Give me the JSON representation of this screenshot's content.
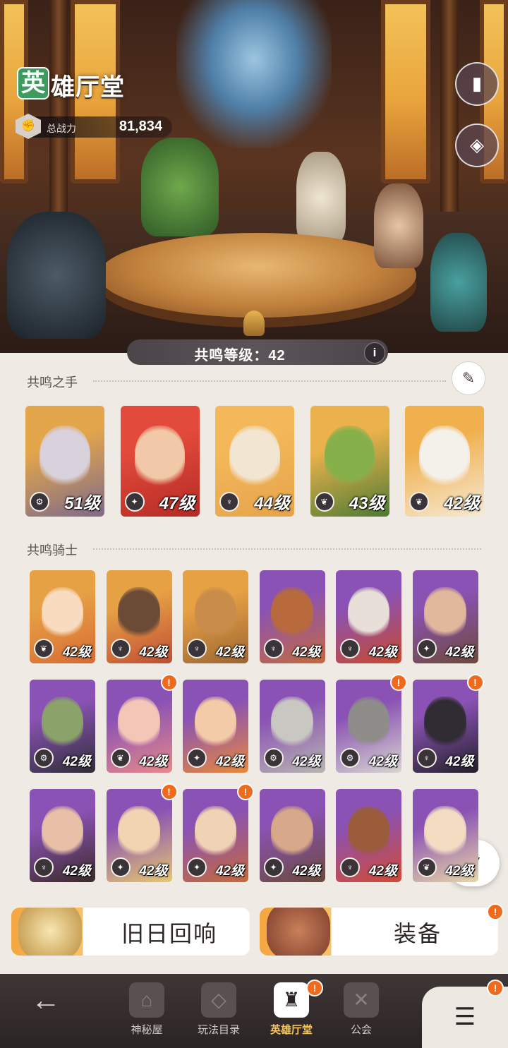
{
  "header": {
    "title_first_char": "英",
    "title_rest": "雄厅堂",
    "power_label": "总战力",
    "power_value": "81,834"
  },
  "top_buttons": [
    {
      "name": "book-icon",
      "glyph": "▮"
    },
    {
      "name": "armor-icon",
      "glyph": "◈"
    }
  ],
  "resonance": {
    "label": "共鸣等级：42",
    "info": "i"
  },
  "hands": {
    "title": "共鸣之手",
    "cards": [
      {
        "level": "51级",
        "art": [
          "#e3a64b",
          "#7f6a8a"
        ],
        "face": "#d9d2dd",
        "cls": "⚙"
      },
      {
        "level": "47级",
        "art": [
          "#e24b3b",
          "#b52a25"
        ],
        "face": "#f1c9a8",
        "cls": "✦"
      },
      {
        "level": "44级",
        "art": [
          "#f3b85a",
          "#e6a34a"
        ],
        "face": "#f2e6d2",
        "cls": "♆"
      },
      {
        "level": "43级",
        "art": [
          "#eab14c",
          "#4d7b33"
        ],
        "face": "#86b04a",
        "cls": "❦"
      },
      {
        "level": "42级",
        "art": [
          "#f0b04d",
          "#f6ead6"
        ],
        "face": "#f4f0ea",
        "cls": "❦"
      }
    ]
  },
  "knights": {
    "title": "共鸣骑士",
    "cards": [
      {
        "level": "42级",
        "art": [
          "#e7a145",
          "#d76b34"
        ],
        "face": "#f7dcc0",
        "cls": "❦",
        "alert": false
      },
      {
        "level": "42级",
        "art": [
          "#e7a145",
          "#c04d35"
        ],
        "face": "#6b4a36",
        "cls": "♆",
        "alert": false
      },
      {
        "level": "42级",
        "art": [
          "#e7a145",
          "#9c6532"
        ],
        "face": "#c98c4a",
        "cls": "♆",
        "alert": false
      },
      {
        "level": "42级",
        "art": [
          "#8a52b4",
          "#c56a3d"
        ],
        "face": "#b86a3c",
        "cls": "♆",
        "alert": false
      },
      {
        "level": "42级",
        "art": [
          "#8a52b4",
          "#c84a2e"
        ],
        "face": "#e8e0d8",
        "cls": "♆",
        "alert": false
      },
      {
        "level": "42级",
        "art": [
          "#8a52b4",
          "#6e4a3a"
        ],
        "face": "#e2b89c",
        "cls": "✦",
        "alert": false
      },
      {
        "level": "42级",
        "art": [
          "#8a52b4",
          "#2e2e36"
        ],
        "face": "#8ba36a",
        "cls": "⚙",
        "alert": false
      },
      {
        "level": "42级",
        "art": [
          "#8a52b4",
          "#e88a8a"
        ],
        "face": "#f4c6b8",
        "cls": "❦",
        "alert": true
      },
      {
        "level": "42级",
        "art": [
          "#8a52b4",
          "#e88a3a"
        ],
        "face": "#f4cba8",
        "cls": "✦",
        "alert": false
      },
      {
        "level": "42级",
        "art": [
          "#8a52b4",
          "#b8b6b0"
        ],
        "face": "#c9c7c2",
        "cls": "⚙",
        "alert": false
      },
      {
        "level": "42级",
        "art": [
          "#8a52b4",
          "#d8d6d0"
        ],
        "face": "#8e8d8a",
        "cls": "⚙",
        "alert": true
      },
      {
        "level": "42级",
        "art": [
          "#8a52b4",
          "#232028"
        ],
        "face": "#2f2c34",
        "cls": "♆",
        "alert": true
      },
      {
        "level": "42级",
        "art": [
          "#8a52b4",
          "#3a2a28"
        ],
        "face": "#e8c0a8",
        "cls": "♆",
        "alert": false
      },
      {
        "level": "42级",
        "art": [
          "#8a52b4",
          "#e6c870"
        ],
        "face": "#f2d4b2",
        "cls": "✦",
        "alert": true
      },
      {
        "level": "42级",
        "art": [
          "#8a52b4",
          "#c56a3a"
        ],
        "face": "#f0d2b4",
        "cls": "✦",
        "alert": true
      },
      {
        "level": "42级",
        "art": [
          "#8a52b4",
          "#6a4a3a"
        ],
        "face": "#d8a88a",
        "cls": "✦",
        "alert": false
      },
      {
        "level": "42级",
        "art": [
          "#8a52b4",
          "#d24a34"
        ],
        "face": "#9a5c3a",
        "cls": "♆",
        "alert": false
      },
      {
        "level": "42级",
        "art": [
          "#8a52b4",
          "#e8d6a6"
        ],
        "face": "#f2dcc2",
        "cls": "❦",
        "alert": false
      }
    ]
  },
  "buttons": {
    "echo_label": "旧日回响",
    "equip_label": "装备",
    "filter_glyph": "⛛"
  },
  "nav": {
    "back": "←",
    "items": [
      {
        "label": "神秘屋",
        "glyph": "⌂"
      },
      {
        "label": "玩法目录",
        "glyph": "◇"
      },
      {
        "label": "英雄厅堂",
        "glyph": "♜"
      },
      {
        "label": "公会",
        "glyph": "✕"
      }
    ],
    "menu": "☰",
    "alert": "!"
  },
  "colors": {
    "alert": "#f06a1c",
    "active_nav": "#f5c65a",
    "title_badge": "#3e9a5e"
  }
}
